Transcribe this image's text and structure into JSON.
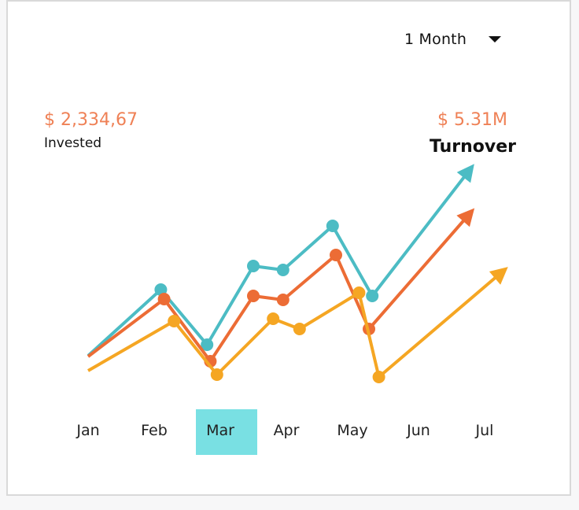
{
  "period_selector": {
    "label": "1 Month",
    "icon": "chevron-down-icon"
  },
  "invested": {
    "amount": "$ 2,334,67",
    "label": "Invested"
  },
  "turnover": {
    "amount": "$ 5.31M",
    "label": "Turnover"
  },
  "colors": {
    "highlight": "#79e0e3",
    "accent_text": "#ef8156"
  },
  "chart_data": {
    "type": "line",
    "categories": [
      "Jan",
      "Feb",
      "Mar",
      "Apr",
      "May",
      "Jun",
      "Jul"
    ],
    "selected_category": "Mar",
    "series": [
      {
        "color": "#4cbcc4",
        "x": [
          0.0,
          1.1,
          1.8,
          2.5,
          2.95,
          3.7,
          4.3,
          5.8
        ],
        "y": [
          38,
          122,
          52,
          152,
          147,
          203,
          114,
          277
        ],
        "markers": [
          false,
          true,
          true,
          true,
          true,
          true,
          true,
          false
        ],
        "arrow_end": true
      },
      {
        "color": "#ec6c35",
        "x": [
          0.0,
          1.15,
          1.85,
          2.5,
          2.95,
          3.75,
          4.25,
          5.8
        ],
        "y": [
          37,
          110,
          31,
          114,
          109,
          166,
          72,
          221
        ],
        "markers": [
          false,
          true,
          true,
          true,
          true,
          true,
          true,
          false
        ],
        "arrow_end": true
      },
      {
        "color": "#f5a623",
        "x": [
          0.0,
          1.3,
          1.95,
          2.8,
          3.2,
          4.1,
          4.4,
          6.3
        ],
        "y": [
          19,
          82,
          14,
          85,
          72,
          118,
          11,
          147
        ],
        "markers": [
          false,
          true,
          true,
          true,
          true,
          true,
          true,
          false
        ],
        "arrow_end": true
      }
    ]
  }
}
